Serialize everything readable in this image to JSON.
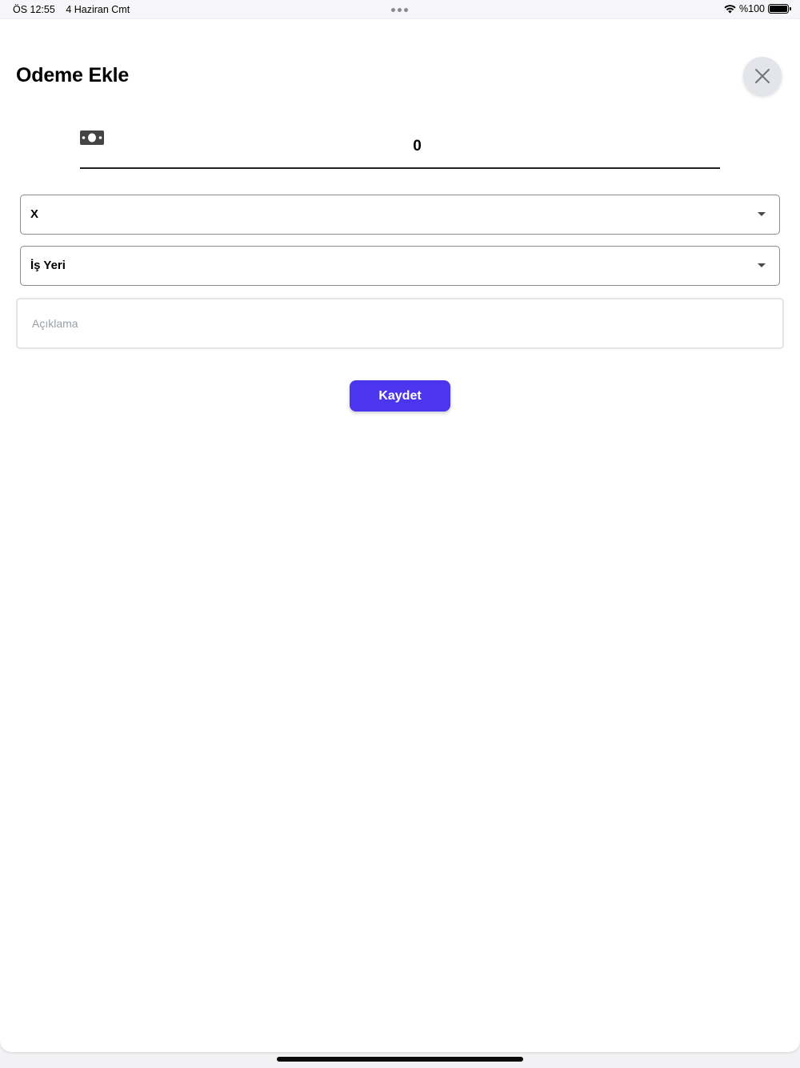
{
  "status_bar": {
    "time": "ÖS 12:55",
    "date": "4 Haziran Cmt",
    "battery": "%100",
    "battery_level": 1.0
  },
  "header": {
    "title": "Odeme Ekle",
    "close_icon": "close-icon"
  },
  "amount": {
    "icon": "money-bill-icon",
    "value": "0"
  },
  "selects": {
    "first_value": "X",
    "second_value": "İş Yeri"
  },
  "description": {
    "placeholder": "Açıklama",
    "value": ""
  },
  "actions": {
    "save_label": "Kaydet"
  },
  "colors": {
    "accent": "#4c35ee",
    "close_button_bg": "#e3e5ea"
  }
}
